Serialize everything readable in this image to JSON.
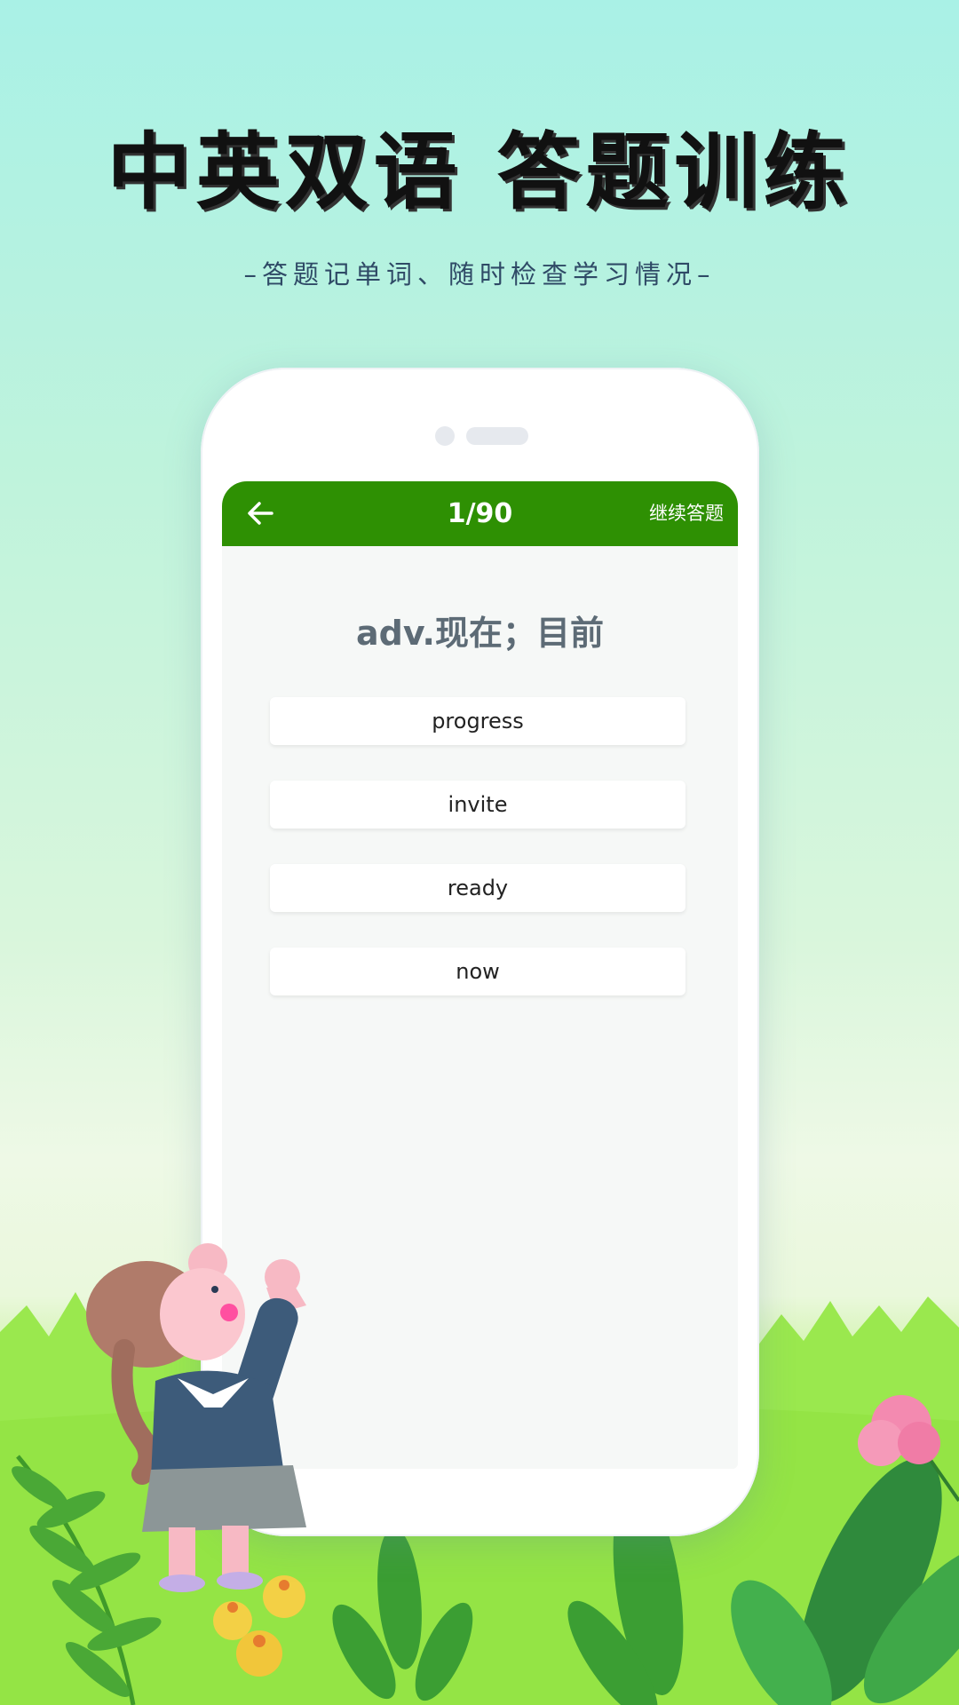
{
  "promo": {
    "headline": "中英双语 答题训练",
    "subline": "–答题记单词、随时检查学习情况–"
  },
  "quiz": {
    "progress": "1/90",
    "continue_label": "继续答题",
    "question": "adv.现在；目前",
    "options": [
      "progress",
      "invite",
      "ready",
      "now"
    ]
  },
  "icons": {
    "back": "arrow-left-icon"
  },
  "colors": {
    "appbar": "#2e9003",
    "question_text": "#5d6b76"
  }
}
